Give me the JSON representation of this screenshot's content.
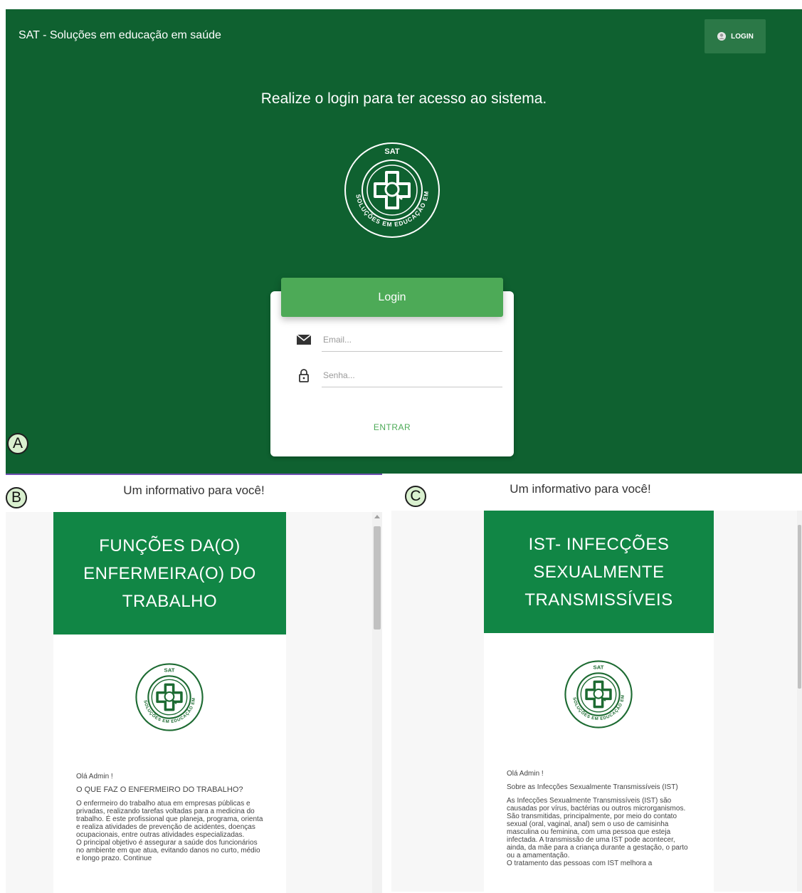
{
  "panel_a": {
    "app_title": "SAT - Soluções em educação em saúde",
    "top_login_label": "LOGIN",
    "headline": "Realize o login para ter acesso ao sistema.",
    "login_card": {
      "header": "Login",
      "email_placeholder": "Email...",
      "password_placeholder": "Senha...",
      "submit_label": "ENTRAR"
    },
    "label": "A"
  },
  "logo": {
    "top_text": "SAT",
    "ring_text": "SOLUÇÕES EM EDUCAÇÃO EM SAÚDE"
  },
  "panel_b": {
    "label": "B",
    "title": "Um informativo para você!",
    "banner_lines": [
      "FUNÇÕES DA(O)",
      "ENFERMEIRA(O) DO",
      "TRABALHO"
    ],
    "greeting": "Olá Admin !",
    "question": "O QUE FAZ O ENFERMEIRO DO TRABALHO?",
    "paragraph1": "O enfermeiro do trabalho atua em empresas públicas e privadas, realizando tarefas voltadas para a medicina do trabalho. É este profissional que planeja, programa, orienta e realiza atividades de prevenção de acidentes, doenças ocupacionais, entre outras atividades especializadas.",
    "paragraph2": "O principal objetivo é assegurar a saúde dos funcionários no ambiente em que atua, evitando danos no curto, médio e longo prazo. Continue"
  },
  "panel_c": {
    "label": "C",
    "title": "Um informativo para você!",
    "banner_lines": [
      "IST- INFECÇÕES",
      "SEXUALMENTE",
      "TRANSMISSÍVEIS"
    ],
    "greeting": "Olá Admin !",
    "subtitle": "Sobre as Infecções Sexualmente Transmissíveis (IST)",
    "paragraph1": "As Infecções Sexualmente Transmissíveis (IST) são causadas por vírus, bactérias ou outros microrganismos. São transmitidas, principalmente, por meio do contato sexual (oral, vaginal, anal) sem o uso de camisinha masculina ou feminina, com uma pessoa que esteja infectada. A transmissão de uma IST pode acontecer, ainda, da mãe para a criança durante a gestação, o parto ou a amamentação.",
    "paragraph2": "O tratamento das pessoas com IST melhora a"
  },
  "colors": {
    "header_green": "#0f6130",
    "login_green": "#4daa57",
    "banner_green": "#118645"
  }
}
